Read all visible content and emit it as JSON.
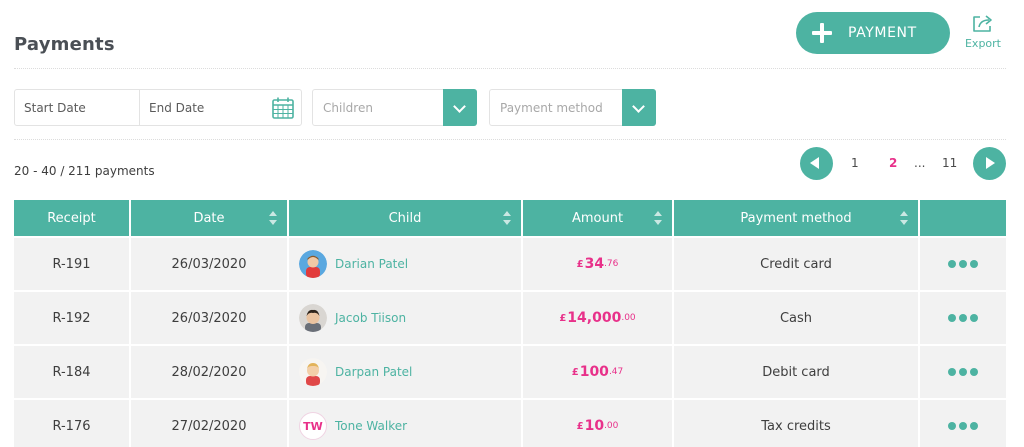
{
  "header": {
    "title": "Payments"
  },
  "actions": {
    "add_payment_label": "PAYMENT",
    "export_label": "Export"
  },
  "filters": {
    "start_date_placeholder": "Start Date",
    "end_date_placeholder": "End Date",
    "children_placeholder": "Children",
    "payment_method_placeholder": "Payment method"
  },
  "summary": {
    "count_text": "20 - 40 / 211 payments"
  },
  "pagination": {
    "pages": [
      "1",
      "2",
      "...",
      "11"
    ],
    "current": "2"
  },
  "table": {
    "columns": [
      "Receipt",
      "Date",
      "Child",
      "Amount",
      "Payment method",
      ""
    ],
    "rows": [
      {
        "receipt": "R-191",
        "date": "26/03/2020",
        "child": "Darian Patel",
        "avatar": "child-photo",
        "currency": "£",
        "amount_major": "34",
        "amount_minor": ".76",
        "method": "Credit card"
      },
      {
        "receipt": "R-192",
        "date": "26/03/2020",
        "child": "Jacob Tiison",
        "avatar": "child-photo",
        "currency": "£",
        "amount_major": "14,000",
        "amount_minor": ".00",
        "method": "Cash"
      },
      {
        "receipt": "R-184",
        "date": "28/02/2020",
        "child": "Darpan Patel",
        "avatar": "child-photo",
        "currency": "£",
        "amount_major": "100",
        "amount_minor": ".47",
        "method": "Debit card"
      },
      {
        "receipt": "R-176",
        "date": "27/02/2020",
        "child": "Tone Walker",
        "avatar_initials": "TW",
        "currency": "£",
        "amount_major": "10",
        "amount_minor": ".00",
        "method": "Tax credits"
      }
    ]
  },
  "colors": {
    "accent": "#4db3a2",
    "highlight": "#e8318a",
    "row_bg": "#f2f2f2"
  },
  "icons": {
    "add": "plus-icon",
    "export": "share-icon",
    "calendar": "calendar-icon",
    "dropdown": "chevron-down-icon",
    "more": "more-dots-icon"
  }
}
